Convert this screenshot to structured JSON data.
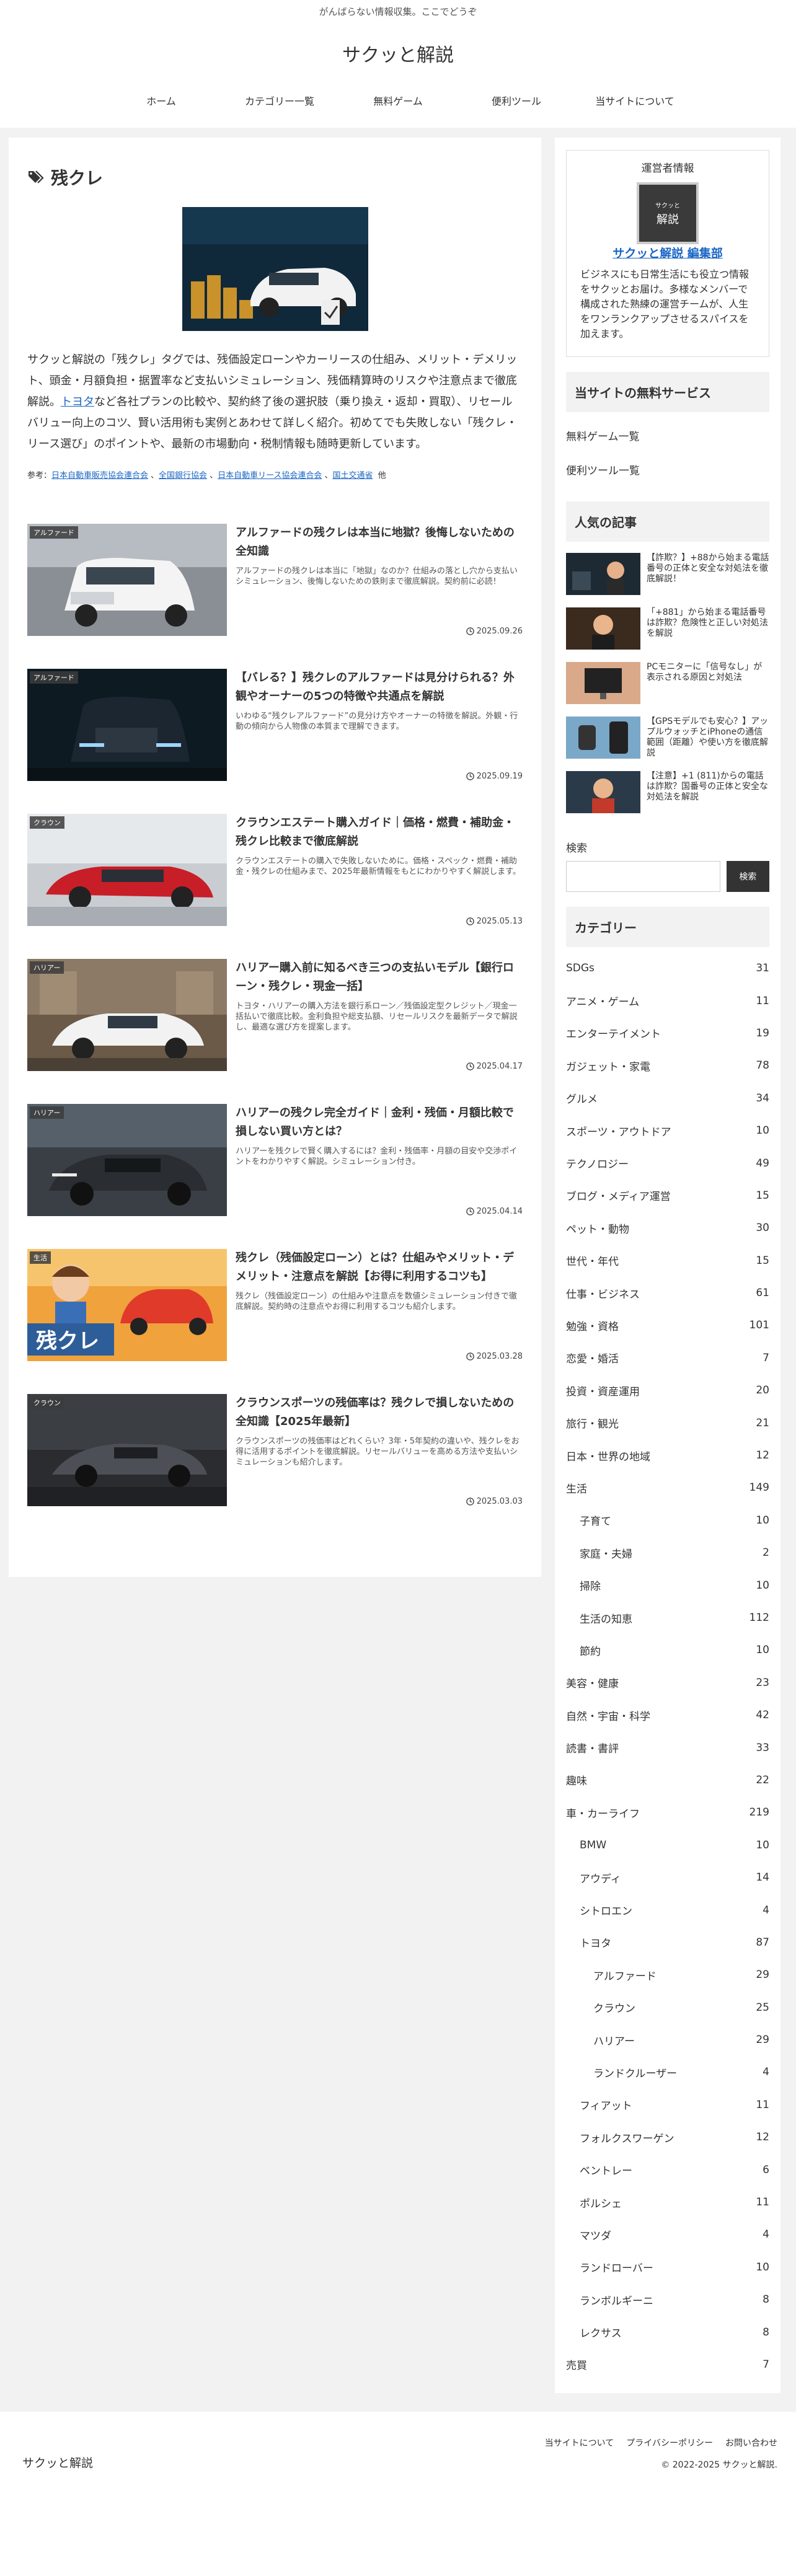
{
  "header": {
    "tagline": "がんばらない情報収集。ここでどうぞ",
    "site_name": "サクッと解説",
    "nav": [
      "ホーム",
      "カテゴリー一覧",
      "無料ゲーム",
      "便利ツール",
      "当サイトについて"
    ]
  },
  "archive": {
    "title": "残クレ",
    "description_before_link": "サクッと解説の「残クレ」タグでは、残価設定ローンやカーリースの仕組み、メリット・デメリット、頭金・月額負担・据置率など支払いシミュレーション、残価精算時のリスクや注意点まで徹底解説。",
    "description_link": "トヨタ",
    "description_after_link": "など各社プランの比較や、契約終了後の選択肢（乗り換え・返却・買取）、リセールバリュー向上のコツ、賢い活用術も実例とあわせて詳しく紹介。初めてでも失敗しない「残クレ・リース選び」のポイントや、最新の市場動向・税制情報も随時更新しています。",
    "refs_label": "参考：",
    "refs": [
      "日本自動車販売協会連合会",
      "全国銀行協会",
      "日本自動車リース協会連合会",
      "国土交通省"
    ],
    "refs_suffix": "他"
  },
  "cards": [
    {
      "category": "アルファード",
      "title": "アルファードの残クレは本当に地獄？後悔しないための全知識",
      "snippet": "アルファードの残クレは本当に「地獄」なのか？仕組みの落とし穴から支払いシミュレーション、後悔しないための鉄則まで徹底解説。契約前に必読！",
      "date": "2025.09.26"
    },
    {
      "category": "アルファード",
      "title": "【バレる？】残クレのアルファードは見分けられる？外観やオーナーの5つの特徴や共通点を解説",
      "snippet": "いわゆる“残クレアルファード”の見分け方やオーナーの特徴を解説。外観・行動の傾向から人物像の本質まで理解できます。",
      "date": "2025.09.19"
    },
    {
      "category": "クラウン",
      "title": "クラウンエステート購入ガイド｜価格・燃費・補助金・残クレ比較まで徹底解説",
      "snippet": "クラウンエステートの購入で失敗しないために。価格・スペック・燃費・補助金・残クレの仕組みまで、2025年最新情報をもとにわかりやすく解説します。",
      "date": "2025.05.13"
    },
    {
      "category": "ハリアー",
      "title": "ハリアー購入前に知るべき三つの支払いモデル【銀行ローン・残クレ・現金一括】",
      "snippet": "トヨタ・ハリアーの購入方法を銀行系ローン／残価設定型クレジット／現金一括払いで徹底比較。金利負担や総支払額、リセールリスクを最新データで解説し、最適な選び方を提案します。",
      "date": "2025.04.17"
    },
    {
      "category": "ハリアー",
      "title": "ハリアーの残クレ完全ガイド｜金利・残価・月額比較で損しない買い方とは？",
      "snippet": "ハリアーを残クレで賢く購入するには？金利・残価率・月額の目安や交渉ポイントをわかりやすく解説。シミュレーション付き。",
      "date": "2025.04.14"
    },
    {
      "category": "生活",
      "title": "残クレ（残価設定ローン）とは？仕組みやメリット・デメリット・注意点を解説【お得に利用するコツも】",
      "snippet": "残クレ（残価設定ローン）の仕組みや注意点を数値シミュレーション付きで徹底解説。契約時の注意点やお得に利用するコツも紹介します。",
      "date": "2025.03.28"
    },
    {
      "category": "クラウン",
      "title": "クラウンスポーツの残価率は？残クレで損しないための全知識【2025年最新】",
      "snippet": "クラウンスポーツの残価率はどれくらい？3年・5年契約の違いや、残クレをお得に活用するポイントを徹底解説。リセールバリューを高める方法や支払いシミュレーションも紹介します。",
      "date": "2025.03.03"
    }
  ],
  "sidebar": {
    "author_heading": "運営者情報",
    "avatar_small": "サクッと",
    "avatar_big": "解説",
    "author_name": "サクッと解説 編集部",
    "author_bio": "ビジネスにも日常生活にも役立つ情報をサクッとお届け。多様なメンバーで構成された熟練の運営チームが、人生をワンランクアップさせるスパイスを加えます。",
    "free_title": "当サイトの無料サービス",
    "free_links": [
      "無料ゲーム一覧",
      "便利ツール一覧"
    ],
    "popular_title": "人気の記事",
    "popular": [
      "【詐欺？】+88から始まる電話番号の正体と安全な対処法を徹底解説！",
      "「+881」から始まる電話番号は詐欺？危険性と正しい対処法を解説",
      "PCモニターに「信号なし」が表示される原因と対処法",
      "【GPSモデルでも安心？】アップルウォッチとiPhoneの通信範囲（距離）や使い方を徹底解説",
      "【注意】+1 (811)からの電話は詐欺？国番号の正体と安全な対処法を解説"
    ],
    "search_label": "検索",
    "search_button": "検索",
    "category_title": "カテゴリー",
    "categories": [
      {
        "name": "SDGs",
        "count": "31",
        "level": 0
      },
      {
        "name": "アニメ・ゲーム",
        "count": "11",
        "level": 0
      },
      {
        "name": "エンターテイメント",
        "count": "19",
        "level": 0
      },
      {
        "name": "ガジェット・家電",
        "count": "78",
        "level": 0
      },
      {
        "name": "グルメ",
        "count": "34",
        "level": 0
      },
      {
        "name": "スポーツ・アウトドア",
        "count": "10",
        "level": 0
      },
      {
        "name": "テクノロジー",
        "count": "49",
        "level": 0
      },
      {
        "name": "ブログ・メディア運営",
        "count": "15",
        "level": 0
      },
      {
        "name": "ペット・動物",
        "count": "30",
        "level": 0
      },
      {
        "name": "世代・年代",
        "count": "15",
        "level": 0
      },
      {
        "name": "仕事・ビジネス",
        "count": "61",
        "level": 0
      },
      {
        "name": "勉強・資格",
        "count": "101",
        "level": 0
      },
      {
        "name": "恋愛・婚活",
        "count": "7",
        "level": 0
      },
      {
        "name": "投資・資産運用",
        "count": "20",
        "level": 0
      },
      {
        "name": "旅行・観光",
        "count": "21",
        "level": 0
      },
      {
        "name": "日本・世界の地域",
        "count": "12",
        "level": 0
      },
      {
        "name": "生活",
        "count": "149",
        "level": 0
      },
      {
        "name": "子育て",
        "count": "10",
        "level": 1
      },
      {
        "name": "家庭・夫婦",
        "count": "2",
        "level": 1
      },
      {
        "name": "掃除",
        "count": "10",
        "level": 1
      },
      {
        "name": "生活の知恵",
        "count": "112",
        "level": 1
      },
      {
        "name": "節約",
        "count": "10",
        "level": 1
      },
      {
        "name": "美容・健康",
        "count": "23",
        "level": 0
      },
      {
        "name": "自然・宇宙・科学",
        "count": "42",
        "level": 0
      },
      {
        "name": "読書・書評",
        "count": "33",
        "level": 0
      },
      {
        "name": "趣味",
        "count": "22",
        "level": 0
      },
      {
        "name": "車・カーライフ",
        "count": "219",
        "level": 0
      },
      {
        "name": "BMW",
        "count": "10",
        "level": 1
      },
      {
        "name": "アウディ",
        "count": "14",
        "level": 1
      },
      {
        "name": "シトロエン",
        "count": "4",
        "level": 1
      },
      {
        "name": "トヨタ",
        "count": "87",
        "level": 1
      },
      {
        "name": "アルファード",
        "count": "29",
        "level": 2
      },
      {
        "name": "クラウン",
        "count": "25",
        "level": 2
      },
      {
        "name": "ハリアー",
        "count": "29",
        "level": 2
      },
      {
        "name": "ランドクルーザー",
        "count": "4",
        "level": 2
      },
      {
        "name": "フィアット",
        "count": "11",
        "level": 1
      },
      {
        "name": "フォルクスワーゲン",
        "count": "12",
        "level": 1
      },
      {
        "name": "ベントレー",
        "count": "6",
        "level": 1
      },
      {
        "name": "ポルシェ",
        "count": "11",
        "level": 1
      },
      {
        "name": "マツダ",
        "count": "4",
        "level": 1
      },
      {
        "name": "ランドローバー",
        "count": "10",
        "level": 1
      },
      {
        "name": "ランボルギーニ",
        "count": "8",
        "level": 1
      },
      {
        "name": "レクサス",
        "count": "8",
        "level": 1
      },
      {
        "name": "売買",
        "count": "7",
        "level": 0
      }
    ]
  },
  "footer": {
    "links": [
      "当サイトについて",
      "プライバシーポリシー",
      "お問い合わせ"
    ],
    "logo": "サクッと解説",
    "copyright": "© 2022-2025 サクッと解説."
  }
}
